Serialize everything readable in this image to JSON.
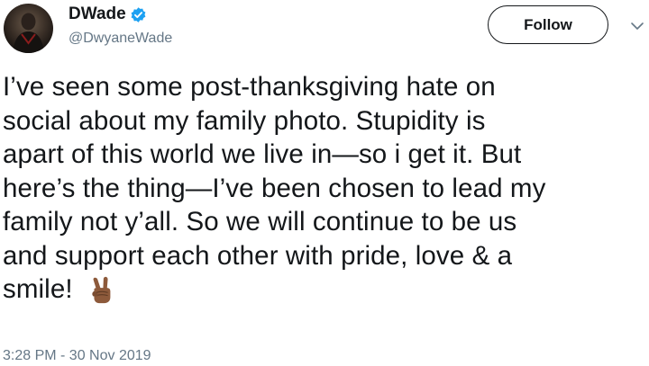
{
  "author": {
    "display_name": "DWade",
    "handle": "@DwyaneWade",
    "verified": true
  },
  "follow_button": {
    "label": "Follow"
  },
  "tweet": {
    "lines": [
      "I’ve seen some post-thanksgiving hate on",
      "social about my family photo. Stupidity is",
      "apart of this world we live in—so i get it. But",
      "here’s the thing—I’ve been chosen to lead my",
      "family not y’all. So we will continue to be us",
      "and support each other with pride, love & a",
      "smile!"
    ],
    "emoji": "victory-hand-medium-dark-skin-tone"
  },
  "timestamp": "3:28 PM - 30 Nov 2019",
  "colors": {
    "text": "#14171a",
    "secondary": "#657786",
    "verified_badge": "#1da1f2"
  }
}
